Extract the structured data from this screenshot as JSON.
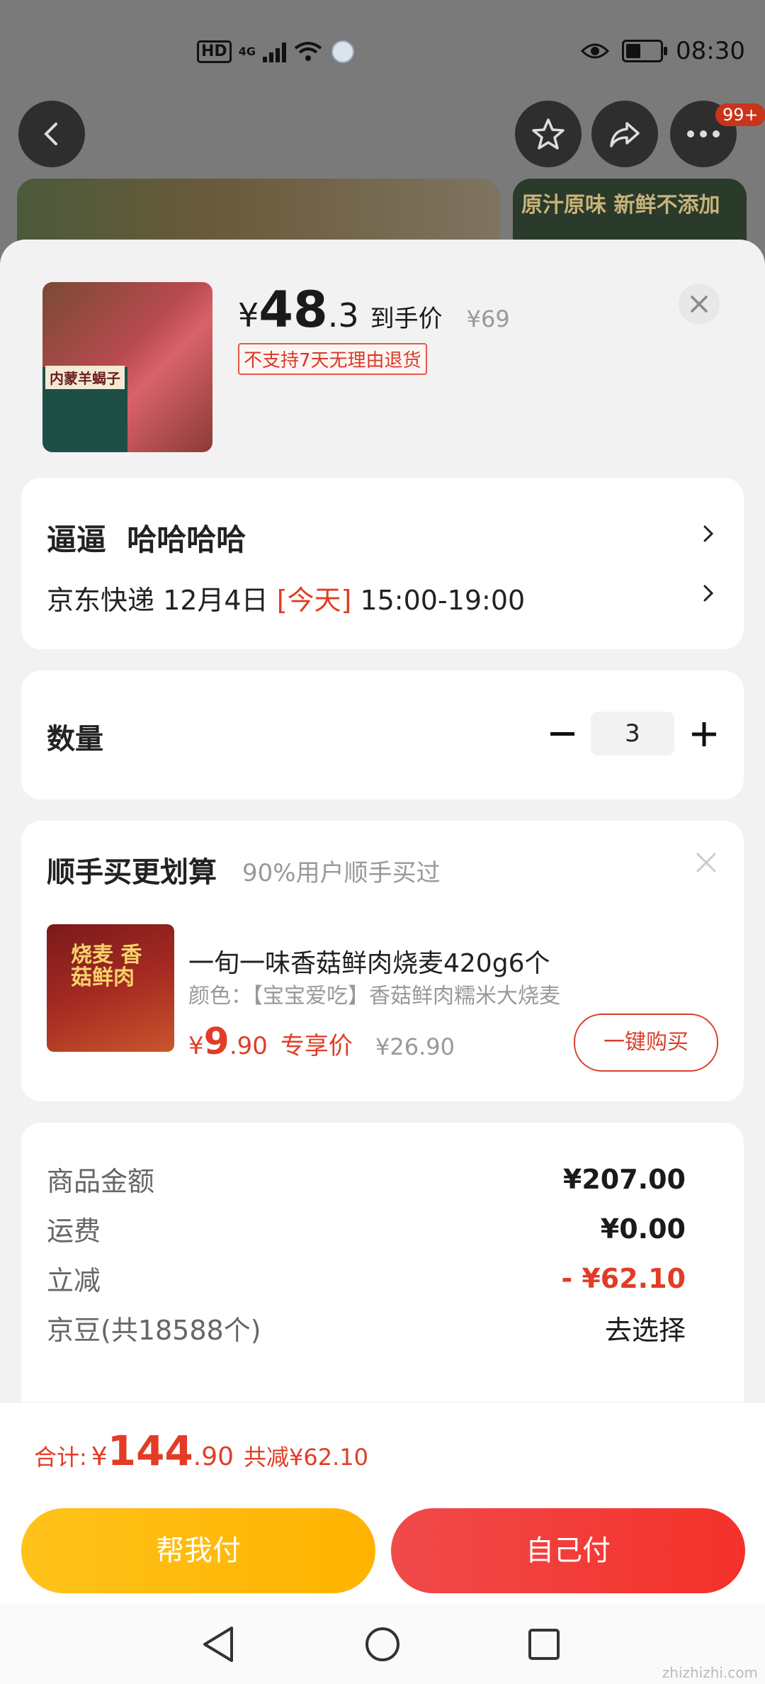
{
  "status_bar": {
    "network_hd": "HD",
    "network_type": "4G",
    "time": "08:30"
  },
  "header": {
    "notification_badge": "99+"
  },
  "banner": {
    "right_text": "原汁原味 新鲜不添加"
  },
  "product": {
    "image_tag": "内蒙羊蝎子",
    "price_currency": "¥",
    "price_int": "48",
    "price_dec": ".3",
    "price_label": "到手价",
    "original_price": "¥69",
    "return_notice": "不支持7天无理由退货"
  },
  "address": {
    "name_line": "逼逼  哈哈哈哈",
    "carrier_date": "京东快递 12月4日 ",
    "today_label": "[今天]",
    "time_window": " 15:00-19:00"
  },
  "quantity": {
    "label": "数量",
    "value": "3"
  },
  "upsell": {
    "title": "顺手买更划算",
    "subtitle": "90%用户顺手买过",
    "image_text": "烧麦 香菇鲜肉",
    "item_name": "一旬一味香菇鲜肉烧麦420g6个",
    "item_color": "颜色：【宝宝爱吃】香菇鲜肉糯米大烧麦",
    "price_currency": "¥",
    "price_int": "9",
    "price_dec": ".90",
    "price_label": "专享价",
    "original_price": "¥26.90",
    "buy_button": "一键购买"
  },
  "summary": {
    "rows": [
      {
        "label": "商品金额",
        "value": "¥207.00"
      },
      {
        "label": "运费",
        "value": "¥0.00"
      },
      {
        "label": "立减",
        "value": "- ¥62.10"
      },
      {
        "label": "京豆(共18588个)",
        "value": "去选择"
      }
    ]
  },
  "total": {
    "label": "合计:",
    "currency": "¥",
    "int": "144",
    "dec": ".90",
    "savings": "共减¥62.10"
  },
  "buttons": {
    "help_pay": "帮我付",
    "self_pay": "自己付"
  },
  "watermark": "zhizhizhi.com",
  "colors": {
    "accent_red": "#e23c26",
    "help_pay_yellow": "#ffb300",
    "self_pay_red": "#f5312a"
  }
}
